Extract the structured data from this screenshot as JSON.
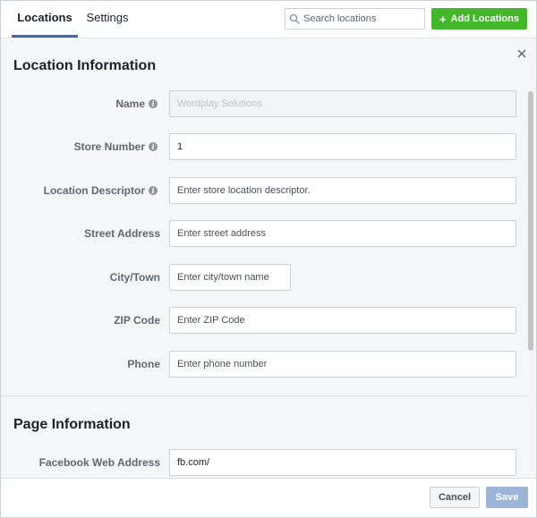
{
  "tabs": [
    {
      "label": "Locations",
      "active": true
    },
    {
      "label": "Settings",
      "active": false
    }
  ],
  "search": {
    "placeholder": "Search locations",
    "icon": "search-icon"
  },
  "add_button": {
    "label": "Add Locations",
    "icon": "plus-icon"
  },
  "location_section": {
    "title": "Location Information",
    "fields": [
      {
        "label": "Name",
        "info": true,
        "value": "",
        "placeholder": "Wordplay Solutions",
        "disabled": true
      },
      {
        "label": "Store Number",
        "info": true,
        "value": "1",
        "placeholder": ""
      },
      {
        "label": "Location Descriptor",
        "info": true,
        "value": "",
        "placeholder": "Enter store location descriptor."
      },
      {
        "label": "Street Address",
        "info": false,
        "value": "",
        "placeholder": "Enter street address"
      },
      {
        "label": "City/Town",
        "info": false,
        "value": "",
        "placeholder": "Enter city/town name"
      },
      {
        "label": "ZIP Code",
        "info": false,
        "value": "",
        "placeholder": "Enter ZIP Code"
      },
      {
        "label": "Phone",
        "info": false,
        "value": "",
        "placeholder": "Enter phone number"
      }
    ]
  },
  "page_section": {
    "title": "Page Information",
    "fields": [
      {
        "label": "Facebook Web Address",
        "info": false,
        "value": "fb.com/",
        "placeholder": ""
      }
    ]
  },
  "footer": {
    "cancel_label": "Cancel",
    "save_label": "Save"
  },
  "colors": {
    "accent_tab": "#4267b2",
    "add_button": "#42b72a",
    "save_disabled": "#9cb4d8"
  }
}
